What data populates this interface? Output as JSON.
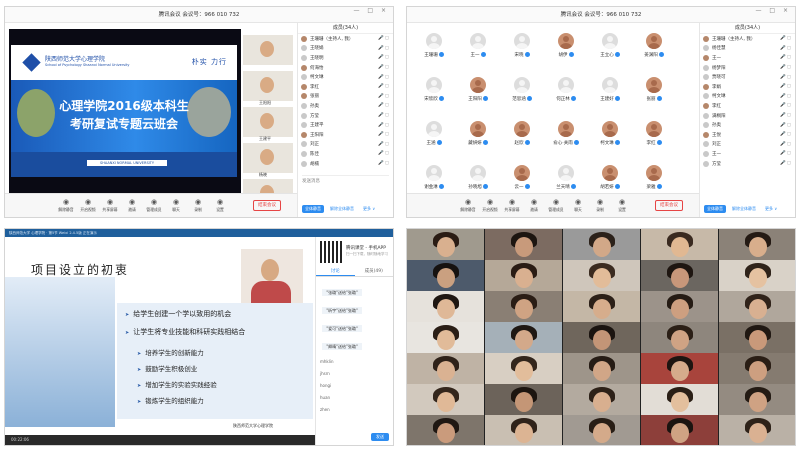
{
  "meeting": {
    "title": "腾讯会议  会议号：966 010 732",
    "window_controls": "— □ ×",
    "members_tab": "成员(34人)",
    "invite_label": "全体静音",
    "unmute_all_label": "解除全体静音",
    "more_label": "更多 ∨",
    "chat_hint": "发送消息",
    "end_meeting": "结束会议",
    "toolbar": [
      {
        "icon": "mic-icon",
        "label": "解除静音"
      },
      {
        "icon": "video-icon",
        "label": "开启视频"
      },
      {
        "icon": "share-screen-icon",
        "label": "共享屏幕"
      },
      {
        "icon": "invite-icon",
        "label": "邀请"
      },
      {
        "icon": "members-icon",
        "label": "管理成员"
      },
      {
        "icon": "chat-icon",
        "label": "聊天"
      },
      {
        "icon": "record-icon",
        "label": "录制"
      },
      {
        "icon": "settings-icon",
        "label": "设置"
      }
    ]
  },
  "q1": {
    "members": [
      {
        "name": "王珊珊（主持人, 我）",
        "photo": true
      },
      {
        "name": "王晓娟",
        "photo": false
      },
      {
        "name": "王晓明",
        "photo": false
      },
      {
        "name": "何海怡",
        "photo": true
      },
      {
        "name": "柯文琳",
        "photo": false
      },
      {
        "name": "李红",
        "photo": true
      },
      {
        "name": "张丽",
        "photo": true
      },
      {
        "name": "孙奥",
        "photo": false
      },
      {
        "name": "方莹",
        "photo": false
      },
      {
        "name": "王建平",
        "photo": false
      },
      {
        "name": "王阳阳",
        "photo": true
      },
      {
        "name": "刘正",
        "photo": false
      },
      {
        "name": "陈佳",
        "photo": false
      },
      {
        "name": "胡楠",
        "photo": false
      }
    ],
    "slide": {
      "school_cn": "陕西师范大学心理学院",
      "school_en": "School of Psychology Shaanxi Normal University",
      "motto": "朴实  力行",
      "title_line1": "心理学院2016级本科生",
      "title_line2": "考研复试专题云班会",
      "footer": "SHAANXI NORMAL UNIVERSITY"
    },
    "cams": [
      {
        "name": ""
      },
      {
        "name": "王阳阳"
      },
      {
        "name": "王建平"
      },
      {
        "name": "杨晓"
      },
      {
        "name": "邓林"
      }
    ]
  },
  "q2": {
    "members": [
      {
        "name": "王珊珊（主持人, 我）",
        "photo": true
      },
      {
        "name": "杨佳慧",
        "photo": false
      },
      {
        "name": "王一",
        "photo": true
      },
      {
        "name": "杨梦阳",
        "photo": false
      },
      {
        "name": "贾晓可",
        "photo": false
      },
      {
        "name": "李娟",
        "photo": true
      },
      {
        "name": "柯文琳",
        "photo": false
      },
      {
        "name": "李红",
        "photo": true
      },
      {
        "name": "满桐阳",
        "photo": false
      },
      {
        "name": "孙奥",
        "photo": false
      },
      {
        "name": "王悦",
        "photo": true
      },
      {
        "name": "刘正",
        "photo": false
      },
      {
        "name": "王一",
        "photo": false
      },
      {
        "name": "方莹",
        "photo": false
      }
    ],
    "grid": [
      {
        "name": "王珊珊",
        "photo": false
      },
      {
        "name": "王一",
        "photo": false
      },
      {
        "name": "宋晓",
        "photo": false
      },
      {
        "name": "胡伊",
        "photo": true
      },
      {
        "name": "王立心",
        "photo": false
      },
      {
        "name": "姜渊阳",
        "photo": true
      },
      {
        "name": "宋欣欣",
        "photo": false
      },
      {
        "name": "王阳阳",
        "photo": true
      },
      {
        "name": "范思涵",
        "photo": false
      },
      {
        "name": "何正林",
        "photo": false
      },
      {
        "name": "王建好",
        "photo": false
      },
      {
        "name": "张丽",
        "photo": true
      },
      {
        "name": "王涵",
        "photo": false
      },
      {
        "name": "藏妍妍",
        "photo": true
      },
      {
        "name": "赵欣",
        "photo": true
      },
      {
        "name": "俞心·关雨",
        "photo": true
      },
      {
        "name": "柯文琳",
        "photo": true
      },
      {
        "name": "李红",
        "photo": true
      },
      {
        "name": "谢金淋",
        "photo": false
      },
      {
        "name": "孙晓旭",
        "photo": false
      },
      {
        "name": "云一",
        "photo": true
      },
      {
        "name": "兰天晴",
        "photo": false
      },
      {
        "name": "胡若妍",
        "photo": true
      },
      {
        "name": "梁雅",
        "photo": true
      }
    ]
  },
  "q3": {
    "topbar": "陕西师范大学  心理学院  ·  第5节 Weixi 2.4.5版  正在演示",
    "slide_title": "项目设立的初衷",
    "bullets_main": [
      "给学生创建一个学以致用的机会",
      "让学生将专业技能和科研实践相结合"
    ],
    "bullets_sub": [
      "培养学生的创新能力",
      "鼓励学生积极创业",
      "增加学生的实验实践经验",
      "锻炼学生的组织能力"
    ],
    "slide_logo": "陕西师范大学心理学院",
    "timer": "00:22:06",
    "app_name": "腾讯课堂 - 手机APP",
    "app_sub": "扫一扫下载，随时随地学习",
    "tabs": [
      "讨论",
      "成员(49)"
    ],
    "msgs": [
      "1",
      "3",
      "11",
      "5",
      "4",
      "3",
      "6",
      "2"
    ],
    "bubbles": [
      "\"张璐\"送给\"张璐\"",
      "\"昕宇\"送给\"张璐\"",
      "\"爱可\"送给\"张璐\"",
      "\"卿晴\"送给\"张璐\""
    ],
    "names": [
      "mhklin",
      "jhsrn",
      "hongi",
      "huan",
      "zhen"
    ],
    "send": "发送"
  },
  "q4": {
    "cells": [
      {
        "name": "",
        "bg": "#a09a8e",
        "face": "#d9b08f",
        "hair": "#2a1c14"
      },
      {
        "name": "",
        "bg": "#7c6b61",
        "face": "#c89a7b",
        "hair": "#1d1510"
      },
      {
        "name": "",
        "bg": "#9a9a9a",
        "face": "#d2a888",
        "hair": "#2b211a"
      },
      {
        "name": "",
        "bg": "#c7b9a8",
        "face": "#e1b892",
        "hair": "#3a2a20"
      },
      {
        "name": "",
        "bg": "#8b8278",
        "face": "#d8ae8c",
        "hair": "#241a14"
      },
      {
        "name": "",
        "bg": "#4d5a6b",
        "face": "#caa080",
        "hair": "#161210"
      },
      {
        "name": "",
        "bg": "#b5a898",
        "face": "#d9b090",
        "hair": "#2a1c14"
      },
      {
        "name": "",
        "bg": "#cfc6bb",
        "face": "#e2bc99",
        "hair": "#3b2b20"
      },
      {
        "name": "",
        "bg": "#6b6660",
        "face": "#c8977a",
        "hair": "#1e1611"
      },
      {
        "name": "",
        "bg": "#d9d2c8",
        "face": "#e5c2a1",
        "hair": "#2f231a"
      },
      {
        "name": "",
        "bg": "#e6e2dc",
        "face": "#dfb897",
        "hair": "#1f1712"
      },
      {
        "name": "",
        "bg": "#8a7f74",
        "face": "#cfa383",
        "hair": "#2a1d15"
      },
      {
        "name": "",
        "bg": "#c4b7a6",
        "face": "#d6ad8c",
        "hair": "#2c2018"
      },
      {
        "name": "",
        "bg": "#9c938a",
        "face": "#cd9f80",
        "hair": "#251b14"
      },
      {
        "name": "",
        "bg": "#b0a79c",
        "face": "#d8b091",
        "hair": "#30231a"
      },
      {
        "name": "",
        "bg": "#e8e5e0",
        "face": "#e1bb99",
        "hair": "#2a1e16"
      },
      {
        "name": "",
        "bg": "#a5b0b8",
        "face": "#d3a98a",
        "hair": "#1f1813"
      },
      {
        "name": "",
        "bg": "#6f665c",
        "face": "#c39577",
        "hair": "#1b1410"
      },
      {
        "name": "",
        "bg": "#8e867d",
        "face": "#cfa384",
        "hair": "#2b1f16"
      },
      {
        "name": "",
        "bg": "#7a7065",
        "face": "#c9997a",
        "hair": "#201812"
      },
      {
        "name": "",
        "bg": "#bfb3a5",
        "face": "#dab292",
        "hair": "#2f2219"
      },
      {
        "name": "",
        "bg": "#d8cfc3",
        "face": "#e2bd9b",
        "hair": "#33261c"
      },
      {
        "name": "",
        "bg": "#9e958a",
        "face": "#d1a687",
        "hair": "#261c15"
      },
      {
        "name": "",
        "bg": "#a8443c",
        "face": "#d5ab8b",
        "hair": "#1d1511"
      },
      {
        "name": "",
        "bg": "#857b70",
        "face": "#cd9f80",
        "hair": "#2a1e15"
      },
      {
        "name": "",
        "bg": "#d2c9be",
        "face": "#e0b997",
        "hair": "#34261c"
      },
      {
        "name": "",
        "bg": "#6c635a",
        "face": "#c49676",
        "hair": "#1c1510"
      },
      {
        "name": "",
        "bg": "#b3aa9f",
        "face": "#d8af8f",
        "hair": "#2d2118"
      },
      {
        "name": "",
        "bg": "#e2ddd6",
        "face": "#e3bf9d",
        "hair": "#2a1f16"
      },
      {
        "name": "",
        "bg": "#948b81",
        "face": "#cfa283",
        "hair": "#241b14"
      },
      {
        "name": "",
        "bg": "#7e756b",
        "face": "#ca9b7c",
        "hair": "#1f1712"
      },
      {
        "name": "",
        "bg": "#c9bfb2",
        "face": "#dcb493",
        "hair": "#30231a"
      },
      {
        "name": "",
        "bg": "#a19a92",
        "face": "#d4aa8a",
        "hair": "#281e16"
      },
      {
        "name": "",
        "bg": "#8d3f3a",
        "face": "#cfa383",
        "hair": "#1b1410"
      },
      {
        "name": "",
        "bg": "#bab1a6",
        "face": "#dab192",
        "hair": "#2e2219"
      }
    ]
  }
}
